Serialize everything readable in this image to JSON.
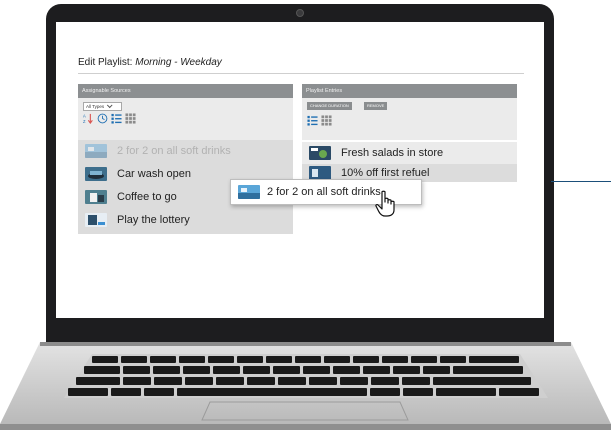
{
  "app": {
    "title_prefix": "Edit Playlist:",
    "playlist_name": "Morning - Weekday"
  },
  "assignable": {
    "header": "Assignable Sources",
    "filter_selected": "All Types",
    "toolbar_icons": [
      "sort-az-icon",
      "clock-icon",
      "list-view-icon",
      "grid-view-icon"
    ],
    "items": [
      {
        "label": "2 for 2 on all soft drinks",
        "state": "dragging-placeholder"
      },
      {
        "label": "Car wash open"
      },
      {
        "label": "Coffee to go"
      },
      {
        "label": "Play the lottery"
      }
    ]
  },
  "entries": {
    "header": "Playlist Entries",
    "buttons": {
      "change_duration": "CHANGE DURATION",
      "remove": "REMOVE"
    },
    "toolbar_icons": [
      "list-view-icon",
      "grid-view-icon"
    ],
    "items": [
      {
        "label": "Fresh salads in store"
      },
      {
        "label": "10% off first refuel"
      }
    ]
  },
  "drag_item": {
    "label": "2 for 2 on all soft drinks"
  },
  "colors": {
    "accent_line": "#1b4f7a",
    "panel_header": "#8c8f91",
    "row_background": "#dcdcdc"
  }
}
